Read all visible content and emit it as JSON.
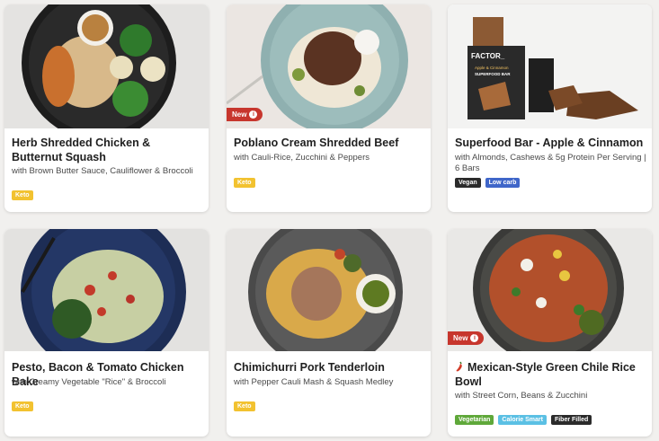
{
  "colors": {
    "page_bg": "#f1f0ee",
    "new_badge": "#c7362d",
    "keto": "#f2c230",
    "vegan": "#2b2b2b",
    "low_carb": "#3f66c9",
    "vegetarian": "#5fa83a",
    "calorie_smart": "#5bc0e4",
    "fiber_filled": "#2b2b2b"
  },
  "badges": {
    "new_label": "New",
    "info_glyph": "i"
  },
  "meals": [
    {
      "title": "Herb Shredded Chicken & Butternut Squash",
      "subtitle": "with Brown Butter Sauce, Cauliflower & Broccoli",
      "tags": [
        "Keto"
      ]
    },
    {
      "title": "Poblano Cream Shredded Beef",
      "subtitle": "with Cauli-Rice, Zucchini & Peppers",
      "tags": [
        "Keto"
      ]
    },
    {
      "title": "Superfood Bar - Apple & Cinnamon",
      "subtitle": "with Almonds, Cashews & 5g Protein Per Serving | 6 Bars",
      "tags": [
        "Vegan",
        "Low carb"
      ],
      "packaging": {
        "brand": "FACTOR_",
        "flavor": "Apple & Cinnamon",
        "product": "SUPERFOOD BAR"
      }
    },
    {
      "title": "Pesto, Bacon & Tomato Chicken Bake",
      "subtitle": "with Creamy Vegetable \"Rice\" & Broccoli",
      "tags": [
        "Keto"
      ]
    },
    {
      "title": "Chimichurri Pork Tenderloin",
      "subtitle": "with Pepper Cauli Mash & Squash Medley",
      "tags": [
        "Keto"
      ]
    },
    {
      "title": "Mexican-Style Green Chile Rice Bowl",
      "subtitle": "with Street Corn, Beans & Zucchini",
      "tags": [
        "Vegetarian",
        "Calorie Smart",
        "Fiber Filled"
      ],
      "icon": "chili-pepper-icon"
    }
  ]
}
